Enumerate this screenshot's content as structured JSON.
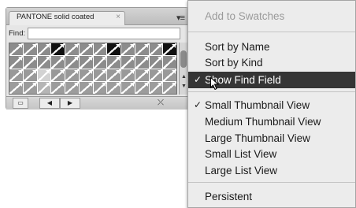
{
  "panel": {
    "tab_label": "PANTONE solid coated",
    "tab_close_glyph": "×",
    "menu_button_glyph": "▾≡",
    "find_label": "Find:",
    "find_value": "",
    "footer": {
      "library_glyph": "▭",
      "prev_glyph": "◀",
      "next_glyph": "▶",
      "tool_glyph": "⤫"
    },
    "scroll": {
      "up_glyph": "▲",
      "down_glyph": "▼"
    },
    "swatches": [
      [
        "#8c8c8c",
        "#8c8c8c",
        "#8c8c8c",
        "#111111",
        "#8c8c8c",
        "#8c8c8c",
        "#8c8c8c",
        "#111111",
        "#8c8c8c",
        "#8c8c8c",
        "#8c8c8c",
        "#111111"
      ],
      [
        "#8c8c8c",
        "#8c8c8c",
        "#8c8c8c",
        "#8c8c8c",
        "#8c8c8c",
        "#8c8c8c",
        "#8c8c8c",
        "#8c8c8c",
        "#8c8c8c",
        "#8c8c8c",
        "#8c8c8c",
        "#8c8c8c"
      ],
      [
        "#999999",
        "#999999",
        "#d2d2d2",
        "#999999",
        "#999999",
        "#999999",
        "#999999",
        "#999999",
        "#999999",
        "#999999",
        "#999999",
        "#999999"
      ],
      [
        "#9c9c9c",
        "#9c9c9c",
        "#b5b5b5",
        "#9c9c9c",
        "#9c9c9c",
        "#9c9c9c",
        "#9c9c9c",
        "#9c9c9c",
        "#9c9c9c",
        "#9c9c9c",
        "#9c9c9c",
        "#9c9c9c"
      ]
    ]
  },
  "menu": {
    "items": [
      {
        "id": "add-to-swatches",
        "label": "Add to Swatches",
        "enabled": false,
        "checked": false,
        "highlighted": false
      },
      {
        "id": "sort-by-name",
        "label": "Sort by Name",
        "enabled": true,
        "checked": false,
        "highlighted": false
      },
      {
        "id": "sort-by-kind",
        "label": "Sort by Kind",
        "enabled": true,
        "checked": false,
        "highlighted": false
      },
      {
        "id": "show-find-field",
        "label": "Show Find Field",
        "enabled": true,
        "checked": true,
        "highlighted": true
      },
      {
        "id": "small-thumbnail-view",
        "label": "Small Thumbnail View",
        "enabled": true,
        "checked": true,
        "highlighted": false
      },
      {
        "id": "medium-thumbnail-view",
        "label": "Medium Thumbnail View",
        "enabled": true,
        "checked": false,
        "highlighted": false
      },
      {
        "id": "large-thumbnail-view",
        "label": "Large Thumbnail View",
        "enabled": true,
        "checked": false,
        "highlighted": false
      },
      {
        "id": "small-list-view",
        "label": "Small List View",
        "enabled": true,
        "checked": false,
        "highlighted": false
      },
      {
        "id": "large-list-view",
        "label": "Large List View",
        "enabled": true,
        "checked": false,
        "highlighted": false
      },
      {
        "id": "persistent",
        "label": "Persistent",
        "enabled": true,
        "checked": false,
        "highlighted": false
      }
    ],
    "check_glyph": "✓"
  }
}
